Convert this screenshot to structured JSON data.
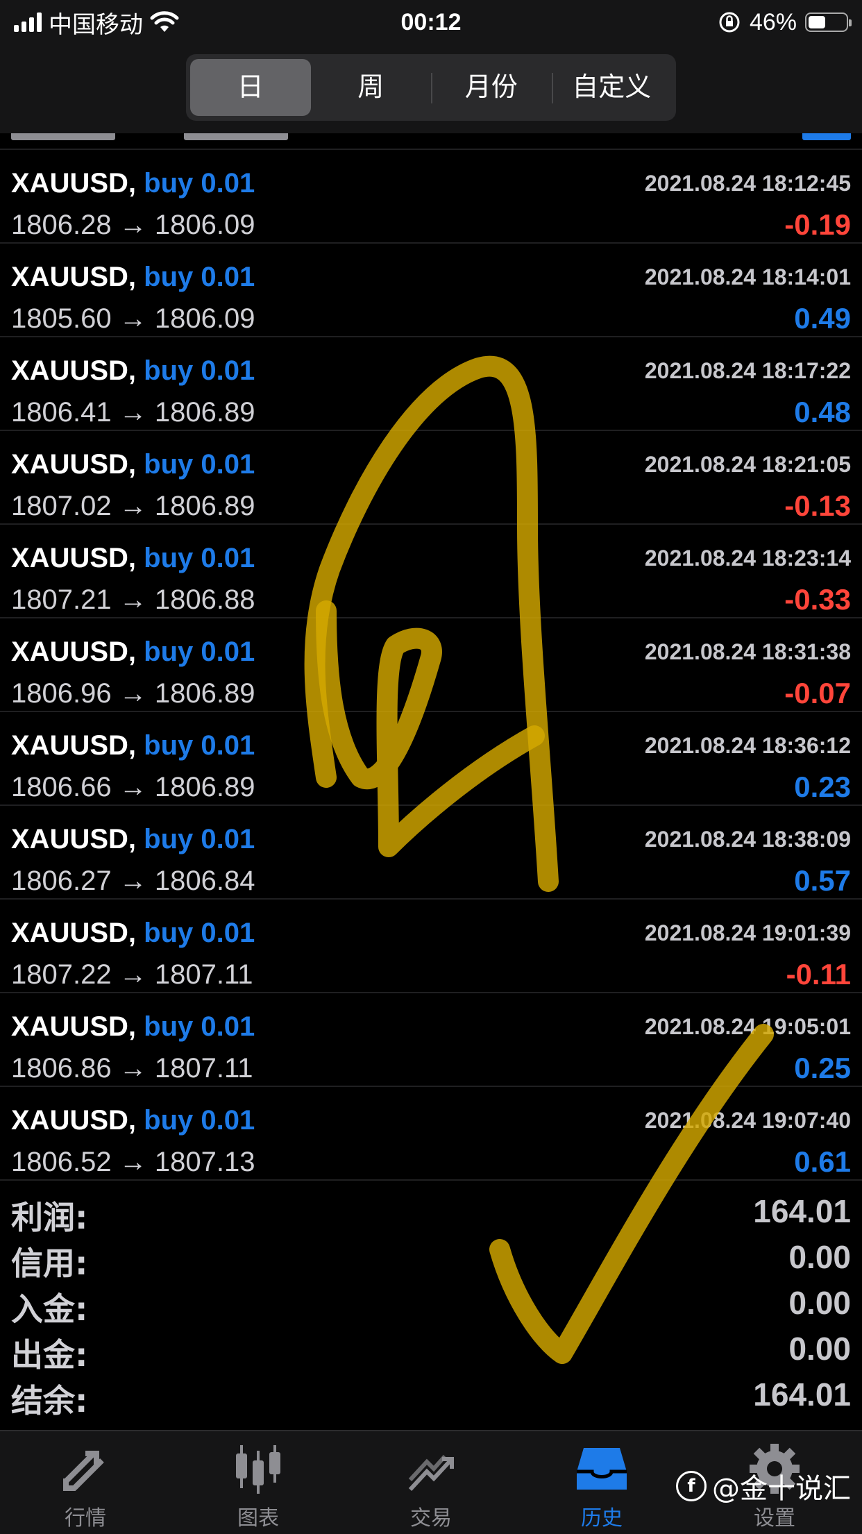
{
  "status_bar": {
    "carrier": "中国移动",
    "time": "00:12",
    "battery_percent": "46%",
    "battery_level": 0.46
  },
  "period_tabs": [
    {
      "label": "日",
      "active": true
    },
    {
      "label": "周",
      "active": false
    },
    {
      "label": "月份",
      "active": false
    },
    {
      "label": "自定义",
      "active": false
    }
  ],
  "trades": [
    {
      "symbol": "XAUUSD,",
      "side": "buy 0.01",
      "time": "2021.08.24 18:12:45",
      "open": "1806.28",
      "close": "1806.09",
      "profit": "-0.19"
    },
    {
      "symbol": "XAUUSD,",
      "side": "buy 0.01",
      "time": "2021.08.24 18:14:01",
      "open": "1805.60",
      "close": "1806.09",
      "profit": "0.49"
    },
    {
      "symbol": "XAUUSD,",
      "side": "buy 0.01",
      "time": "2021.08.24 18:17:22",
      "open": "1806.41",
      "close": "1806.89",
      "profit": "0.48"
    },
    {
      "symbol": "XAUUSD,",
      "side": "buy 0.01",
      "time": "2021.08.24 18:21:05",
      "open": "1807.02",
      "close": "1806.89",
      "profit": "-0.13"
    },
    {
      "symbol": "XAUUSD,",
      "side": "buy 0.01",
      "time": "2021.08.24 18:23:14",
      "open": "1807.21",
      "close": "1806.88",
      "profit": "-0.33"
    },
    {
      "symbol": "XAUUSD,",
      "side": "buy 0.01",
      "time": "2021.08.24 18:31:38",
      "open": "1806.96",
      "close": "1806.89",
      "profit": "-0.07"
    },
    {
      "symbol": "XAUUSD,",
      "side": "buy 0.01",
      "time": "2021.08.24 18:36:12",
      "open": "1806.66",
      "close": "1806.89",
      "profit": "0.23"
    },
    {
      "symbol": "XAUUSD,",
      "side": "buy 0.01",
      "time": "2021.08.24 18:38:09",
      "open": "1806.27",
      "close": "1806.84",
      "profit": "0.57"
    },
    {
      "symbol": "XAUUSD,",
      "side": "buy 0.01",
      "time": "2021.08.24 19:01:39",
      "open": "1807.22",
      "close": "1807.11",
      "profit": "-0.11"
    },
    {
      "symbol": "XAUUSD,",
      "side": "buy 0.01",
      "time": "2021.08.24 19:05:01",
      "open": "1806.86",
      "close": "1807.11",
      "profit": "0.25"
    },
    {
      "symbol": "XAUUSD,",
      "side": "buy 0.01",
      "time": "2021.08.24 19:07:40",
      "open": "1806.52",
      "close": "1807.13",
      "profit": "0.61"
    }
  ],
  "arrow": "→",
  "summary": [
    {
      "label": "利润:",
      "value": "164.01"
    },
    {
      "label": "信用:",
      "value": "0.00"
    },
    {
      "label": "入金:",
      "value": "0.00"
    },
    {
      "label": "出金:",
      "value": "0.00"
    },
    {
      "label": "结余:",
      "value": "164.01"
    }
  ],
  "tabbar": [
    {
      "label": "行情",
      "icon": "quotes-icon",
      "active": false
    },
    {
      "label": "图表",
      "icon": "chart-icon",
      "active": false
    },
    {
      "label": "交易",
      "icon": "trade-icon",
      "active": false
    },
    {
      "label": "历史",
      "icon": "history-icon",
      "active": true
    },
    {
      "label": "设置",
      "icon": "settings-icon",
      "active": false
    }
  ],
  "watermark": "@金十说汇",
  "colors": {
    "accent_blue": "#1e7be8",
    "loss_red": "#ff453a",
    "scribble_gold": "#d4a800"
  }
}
